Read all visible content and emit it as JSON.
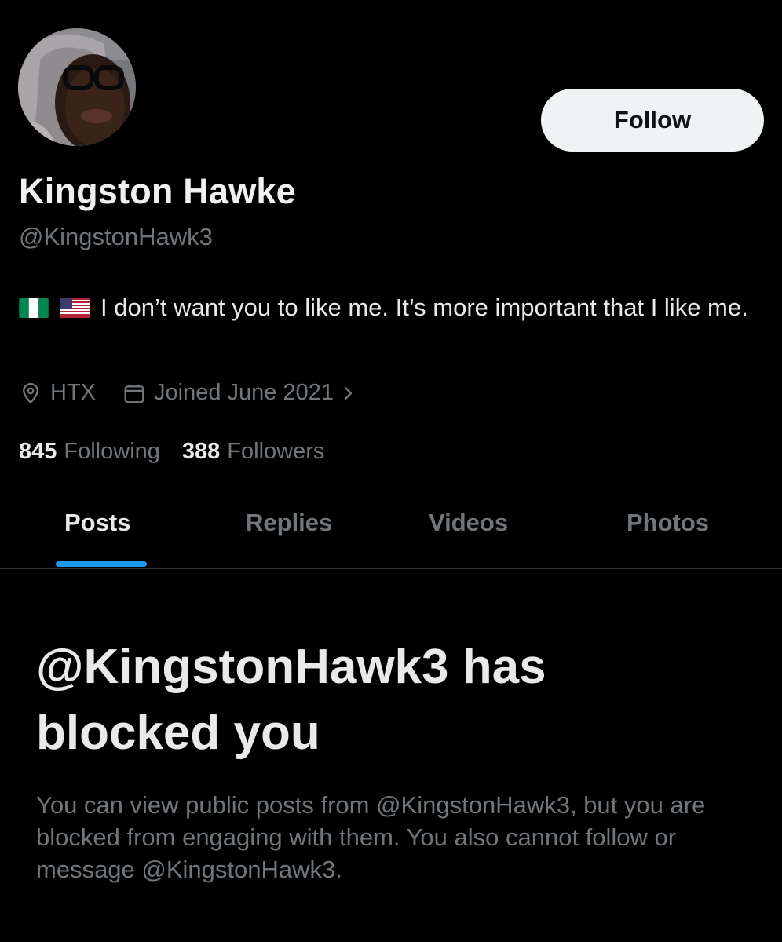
{
  "profile": {
    "display_name": "Kingston Hawke",
    "handle": "@KingstonHawk3",
    "bio_text": "I don’t want you to like me. It’s more important that I like me.",
    "bio_flags": [
      "nigeria-flag-icon",
      "usa-flag-icon"
    ],
    "location": "HTX",
    "joined": "Joined June 2021",
    "following_count": "845",
    "following_label": "Following",
    "followers_count": "388",
    "followers_label": "Followers"
  },
  "actions": {
    "follow_label": "Follow"
  },
  "tabs": [
    {
      "label": "Posts",
      "active": true
    },
    {
      "label": "Replies",
      "active": false
    },
    {
      "label": "Videos",
      "active": false
    },
    {
      "label": "Photos",
      "active": false
    }
  ],
  "blocked": {
    "title": "@KingstonHawk3 has blocked you",
    "description": "You can view public posts from @KingstonHawk3, but you are blocked from engaging with them. You also cannot follow or message @KingstonHawk3."
  },
  "colors": {
    "background": "#000000",
    "accent": "#1d9bf0",
    "primary_text": "#e7e9ea",
    "secondary_text": "#71767b",
    "follow_button_bg": "#eff3f4"
  }
}
